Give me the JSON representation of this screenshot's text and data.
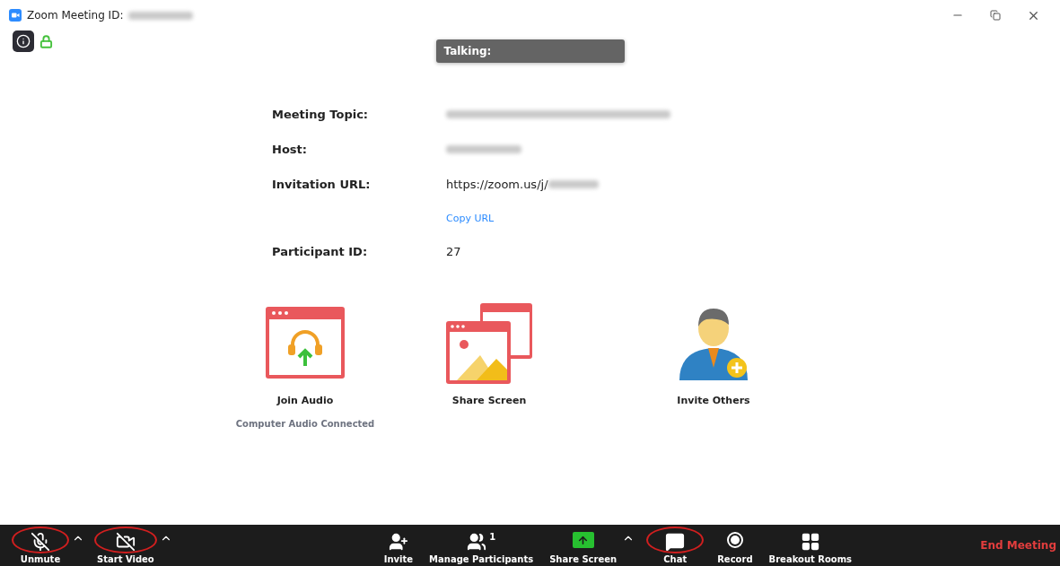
{
  "window": {
    "title": "Zoom Meeting ID:",
    "title_redacted": true
  },
  "security": {
    "locked": true
  },
  "talking_indicator": {
    "label": "Talking:"
  },
  "meeting_info": [
    {
      "label": "Meeting Topic:",
      "redacted": true
    },
    {
      "label": "Host:",
      "redacted": true
    },
    {
      "label": "Invitation URL:",
      "value": "https://zoom.us/j/",
      "redacted": true,
      "link": "Copy URL"
    },
    {
      "label": "Participant ID:",
      "value": "27",
      "redacted": false
    }
  ],
  "actions": [
    {
      "kind": "join_audio",
      "label": "Join Audio",
      "status": "Computer Audio Connected"
    },
    {
      "kind": "share_screen",
      "label": "Share Screen"
    },
    {
      "kind": "invite",
      "label": "Invite Others"
    }
  ],
  "toolbar": {
    "items": [
      {
        "kind": "mic_off",
        "label": "Unmute",
        "menu": true,
        "circled": true
      },
      {
        "kind": "video_off",
        "label": "Start Video",
        "menu": true,
        "circled": true
      },
      {
        "kind": "invite",
        "label": "Invite",
        "menu": false,
        "circled": false
      },
      {
        "kind": "participants",
        "label": "Manage Participants",
        "count": "1",
        "menu": false,
        "circled": false
      },
      {
        "kind": "share",
        "label": "Share Screen",
        "menu": true,
        "circled": false
      },
      {
        "kind": "chat",
        "label": "Chat",
        "menu": false,
        "circled": true
      },
      {
        "kind": "record",
        "label": "Record",
        "menu": false,
        "circled": false
      },
      {
        "kind": "breakout",
        "label": "Breakout Rooms",
        "menu": false,
        "circled": false
      }
    ],
    "end_button": "End Meeting"
  }
}
